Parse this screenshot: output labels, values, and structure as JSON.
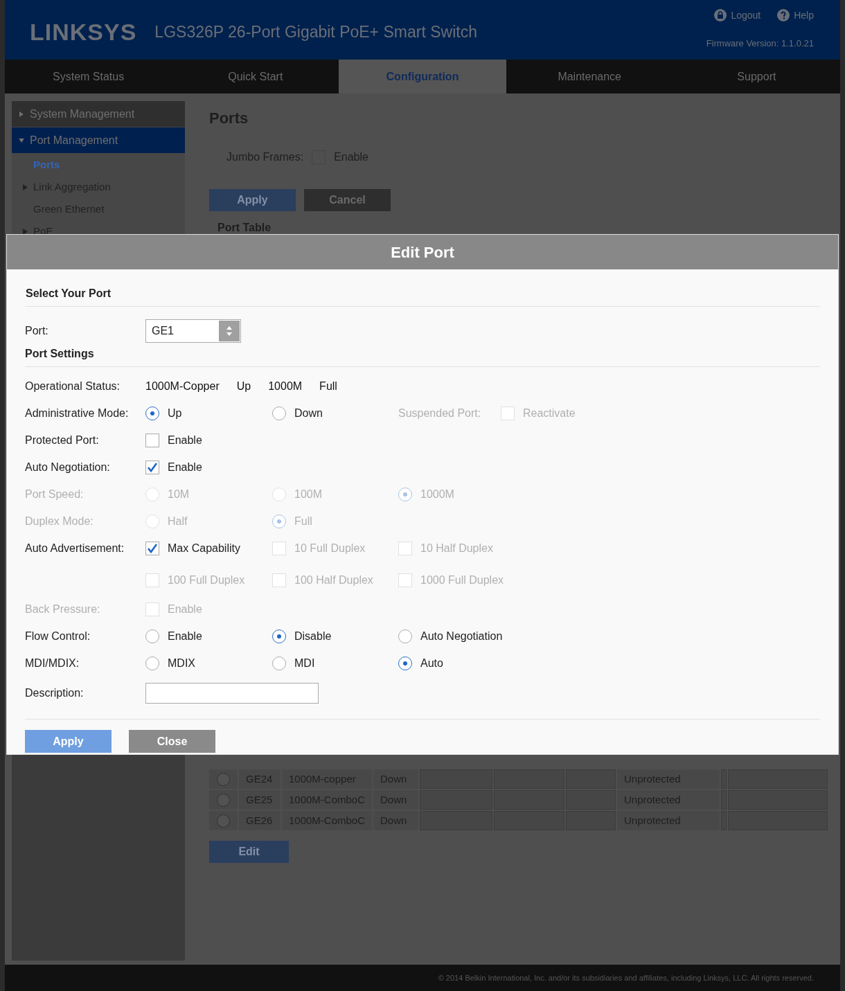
{
  "header": {
    "brand": "LINKSYS",
    "product": "LGS326P 26-Port Gigabit PoE+ Smart Switch",
    "links": [
      {
        "label": "Logout",
        "kind": "lock"
      },
      {
        "label": "Help",
        "kind": "help"
      }
    ],
    "firmware": "Firmware Version: 1.1.0.21"
  },
  "nav": [
    {
      "label": "System Status",
      "selected": false
    },
    {
      "label": "Quick Start",
      "selected": false
    },
    {
      "label": "Configuration",
      "selected": true
    },
    {
      "label": "Maintenance",
      "selected": false
    },
    {
      "label": "Support",
      "selected": false
    }
  ],
  "sidebar": [
    {
      "label": "System Management",
      "expanded": false,
      "selected": false
    },
    {
      "label": "Port Management",
      "expanded": true,
      "selected": true,
      "children": [
        {
          "label": "Ports",
          "kind": "page",
          "selected": true
        },
        {
          "label": "Link Aggregation",
          "kind": "folder",
          "selected": false
        },
        {
          "label": "Green Ethernet",
          "kind": "page",
          "selected": false
        },
        {
          "label": "PoE",
          "kind": "folder",
          "selected": false
        }
      ]
    }
  ],
  "page": {
    "title": "Ports",
    "jumbo_label": "Jumbo Frames:",
    "jumbo_checked": false,
    "jumbo_option": "Enable",
    "buttons": [
      "Apply",
      "Cancel"
    ],
    "table_title": "Port Table",
    "rows": [
      {
        "selected": false,
        "cells": [
          "GE24",
          "1000M-copper",
          "Down",
          "Unprotected"
        ]
      },
      {
        "selected": false,
        "cells": [
          "GE25",
          "1000M-ComboC",
          "Down",
          "Unprotected"
        ]
      },
      {
        "selected": false,
        "cells": [
          "GE26",
          "1000M-ComboC",
          "Down",
          "Unprotected"
        ]
      }
    ],
    "edit_button": "Edit"
  },
  "footer": "© 2014 Belkin International, Inc. and/or its subsidiaries and affiliates, including Linksys, LLC. All rights reserved.",
  "dialog": {
    "title": "Edit Port",
    "select_heading": "Select Your Port",
    "port_label": "Port:",
    "port_value": "GE1",
    "settings_heading": "Port Settings",
    "status_label": "Operational Status:",
    "status_values": [
      "1000M-Copper",
      "Up",
      "1000M",
      "Full"
    ],
    "rows": [
      {
        "label": "Administrative Mode:",
        "disabled": false,
        "options": [
          {
            "kind": "radio",
            "label": "Up",
            "selected": true,
            "disabled": false
          },
          {
            "kind": "radio",
            "label": "Down",
            "selected": false,
            "disabled": false
          },
          {
            "kind": "text",
            "label": "Suspended Port:",
            "disabled": true
          },
          {
            "kind": "checkbox",
            "label": "Reactivate",
            "checked": false,
            "disabled": true
          }
        ]
      },
      {
        "label": "Protected Port:",
        "disabled": false,
        "options": [
          {
            "kind": "checkbox",
            "label": "Enable",
            "checked": false,
            "disabled": false
          }
        ]
      },
      {
        "label": "Auto Negotiation:",
        "disabled": false,
        "options": [
          {
            "kind": "checkbox",
            "label": "Enable",
            "checked": true,
            "disabled": false
          }
        ]
      },
      {
        "label": "Port Speed:",
        "disabled": true,
        "options": [
          {
            "kind": "radio",
            "label": "10M",
            "selected": false,
            "disabled": true
          },
          {
            "kind": "radio",
            "label": "100M",
            "selected": false,
            "disabled": true
          },
          {
            "kind": "radio",
            "label": "1000M",
            "selected": true,
            "disabled": true
          }
        ]
      },
      {
        "label": "Duplex Mode:",
        "disabled": true,
        "options": [
          {
            "kind": "radio",
            "label": "Half",
            "selected": false,
            "disabled": true
          },
          {
            "kind": "radio",
            "label": "Full",
            "selected": true,
            "disabled": true
          }
        ]
      },
      {
        "label": "Auto Advertisement:",
        "disabled": false,
        "options": [
          {
            "kind": "checkbox",
            "label": "Max Capability",
            "checked": true,
            "disabled": false
          },
          {
            "kind": "checkbox",
            "label": "10 Full Duplex",
            "checked": false,
            "disabled": true
          },
          {
            "kind": "checkbox",
            "label": "10 Half Duplex",
            "checked": false,
            "disabled": true
          }
        ]
      },
      {
        "options": [
          {
            "kind": "checkbox",
            "label": "100 Full Duplex",
            "checked": false,
            "disabled": true
          },
          {
            "kind": "checkbox",
            "label": "100 Half Duplex",
            "checked": false,
            "disabled": true
          },
          {
            "kind": "checkbox",
            "label": "1000 Full Duplex",
            "checked": false,
            "disabled": true
          }
        ]
      },
      {
        "label": "Back Pressure:",
        "disabled": true,
        "options": [
          {
            "kind": "checkbox",
            "label": "Enable",
            "checked": false,
            "disabled": true
          }
        ]
      },
      {
        "label": "Flow Control:",
        "disabled": false,
        "options": [
          {
            "kind": "radio",
            "label": "Enable",
            "selected": false,
            "disabled": false
          },
          {
            "kind": "radio",
            "label": "Disable",
            "selected": true,
            "disabled": false
          },
          {
            "kind": "radio",
            "label": "Auto Negotiation",
            "selected": false,
            "disabled": false
          }
        ]
      },
      {
        "label": "MDI/MDIX:",
        "disabled": false,
        "options": [
          {
            "kind": "radio",
            "label": "MDIX",
            "selected": false,
            "disabled": false
          },
          {
            "kind": "radio",
            "label": "MDI",
            "selected": false,
            "disabled": false
          },
          {
            "kind": "radio",
            "label": "Auto",
            "selected": true,
            "disabled": false
          }
        ]
      }
    ],
    "description_label": "Description:",
    "buttons": [
      {
        "label": "Apply",
        "kind": "primary"
      },
      {
        "label": "Close",
        "kind": "secondary"
      }
    ]
  }
}
